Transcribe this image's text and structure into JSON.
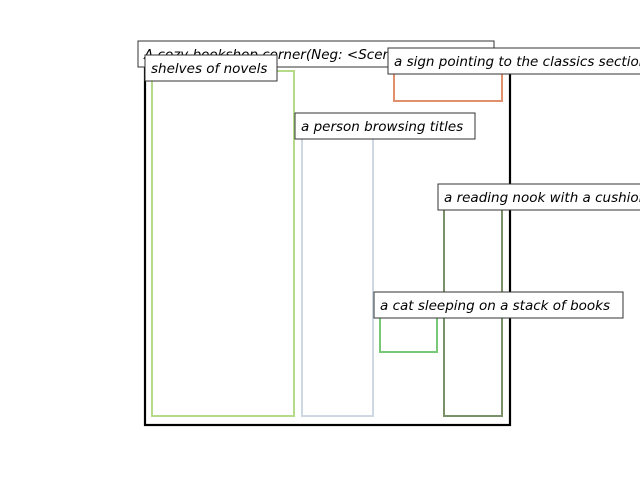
{
  "scene": {
    "caption": "A cozy bookshop corner(Neg: <Scene Four Ends>)",
    "frame_color": "#000000"
  },
  "regions": [
    {
      "id": "shelves",
      "label": "shelves of novels",
      "color": "#b5da89"
    },
    {
      "id": "person",
      "label": "a person browsing titles",
      "color": "#cdd8e3"
    },
    {
      "id": "sign",
      "label": "a sign pointing to the classics section",
      "color": "#e0906a"
    },
    {
      "id": "nook",
      "label": "a reading nook with a cushioned chair",
      "color": "#7a9068"
    },
    {
      "id": "cat",
      "label": "a cat sleeping on a stack of books",
      "color": "#78c878"
    }
  ]
}
